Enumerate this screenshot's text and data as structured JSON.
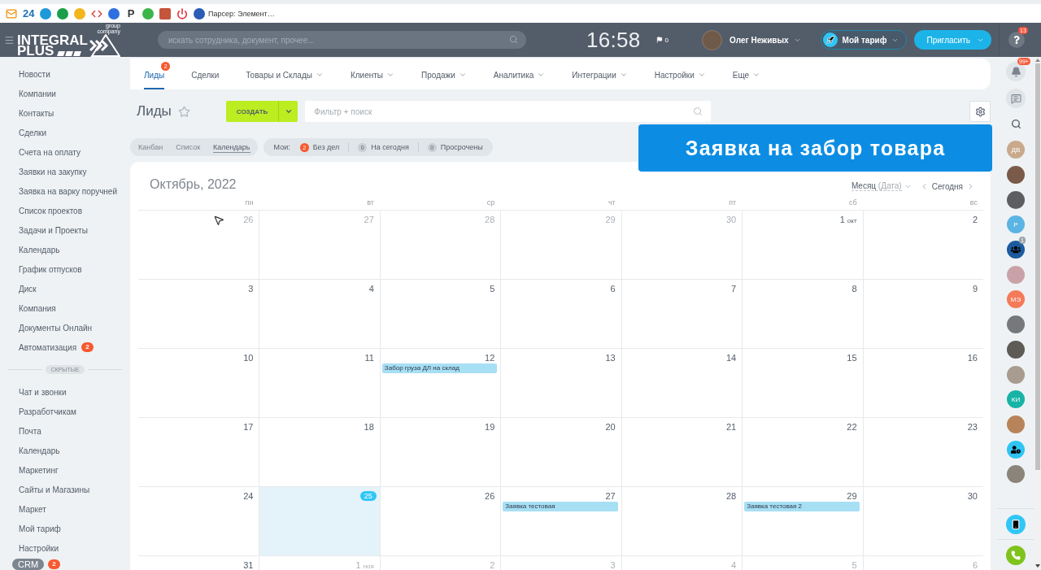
{
  "browser": {
    "bookmarks": [
      {
        "kind": "mail",
        "color": "#f0a02c"
      },
      {
        "kind": "text",
        "label": "24",
        "color": "#1f6fb5"
      },
      {
        "kind": "dot",
        "color": "#1e9ad8"
      },
      {
        "kind": "dot",
        "color": "#1a9e4a"
      },
      {
        "kind": "dot",
        "color": "#f2b51a"
      },
      {
        "kind": "code",
        "color": "#d6453d"
      },
      {
        "kind": "dot",
        "color": "#2f6fe0"
      },
      {
        "kind": "text",
        "label": "P",
        "color": "#333333"
      },
      {
        "kind": "dot",
        "color": "#3cb54a"
      },
      {
        "kind": "square",
        "color": "#c4553b"
      },
      {
        "kind": "power",
        "color": "#e0383e"
      },
      {
        "kind": "dot",
        "color": "#2a5db5",
        "label": "Парсер: Элемент…"
      }
    ]
  },
  "header": {
    "logo": {
      "lines": [
        "INTEGRAL",
        "PLUS"
      ],
      "tagline": [
        "group",
        "company"
      ]
    },
    "search": {
      "placeholder": "искать сотрудника, документ, прочее..."
    },
    "clock": "16:58",
    "flag_count": "0",
    "user": {
      "name": "Олег Неживых"
    },
    "tariff_button": "Мой тариф",
    "invite_button": "Пригласить",
    "help_badge": "13"
  },
  "sidebar": {
    "items": [
      {
        "label": "Новости"
      },
      {
        "label": "Компании"
      },
      {
        "label": "Контакты"
      },
      {
        "label": "Сделки"
      },
      {
        "label": "Счета на оплату"
      },
      {
        "label": "Заявки на закупку"
      },
      {
        "label": "Заявка на варку поручней"
      },
      {
        "label": "Список проектов"
      },
      {
        "label": "Задачи и Проекты"
      },
      {
        "label": "Календарь"
      },
      {
        "label": "График отпусков"
      },
      {
        "label": "Диск"
      },
      {
        "label": "Компания"
      },
      {
        "label": "Документы Онлайн"
      },
      {
        "label": "Автоматизация",
        "badge": "2"
      }
    ],
    "divider": "СКРЫТЫЕ",
    "hidden_items": [
      {
        "label": "Чат и звонки"
      },
      {
        "label": "Разработчикам"
      },
      {
        "label": "Почта"
      },
      {
        "label": "Календарь"
      },
      {
        "label": "Маркетинг"
      },
      {
        "label": "Сайты и Магазины"
      },
      {
        "label": "Маркет"
      },
      {
        "label": "Мой тариф"
      },
      {
        "label": "Настройки"
      }
    ],
    "chip": {
      "label": "CRM",
      "badge": "2"
    }
  },
  "top_nav": {
    "tabs": [
      {
        "label": "Лиды",
        "selected": true,
        "badge": "2",
        "dropdown": false
      },
      {
        "label": "Сделки",
        "selected": false,
        "dropdown": false
      },
      {
        "label": "Товары и Склады",
        "selected": false,
        "dropdown": true
      },
      {
        "label": "Клиенты",
        "selected": false,
        "dropdown": true
      },
      {
        "label": "Продажи",
        "selected": false,
        "dropdown": true
      },
      {
        "label": "Аналитика",
        "selected": false,
        "dropdown": true
      },
      {
        "label": "Интеграции",
        "selected": false,
        "dropdown": true
      },
      {
        "label": "Настройки",
        "selected": false,
        "dropdown": true
      },
      {
        "label": "Еще",
        "selected": false,
        "dropdown": true
      }
    ]
  },
  "toolbar": {
    "title": "Лиды",
    "create_button": "СОЗДАТЬ",
    "filter": {
      "placeholder": "Фильтр + поиск"
    }
  },
  "views": [
    {
      "label": "Канбан",
      "selected": false
    },
    {
      "label": "Список",
      "selected": false
    },
    {
      "label": "Календарь",
      "selected": true
    }
  ],
  "counters": {
    "label": "Мои:",
    "items": [
      {
        "count": "2",
        "label": "Без дел",
        "active": true
      },
      {
        "count": "0",
        "label": "На сегодня",
        "active": false
      },
      {
        "count": "0",
        "label": "Просрочены",
        "active": false
      }
    ]
  },
  "banner": {
    "text": "Заявка на забор товара"
  },
  "calendar": {
    "title": "Октябрь, 2022",
    "view_mode": "Месяц",
    "view_mode_hint": "(Дата)",
    "today_button": "Сегодня",
    "weekdays": [
      "пн",
      "вт",
      "ср",
      "чт",
      "пт",
      "сб",
      "вс"
    ],
    "weeks": [
      {
        "days": [
          {
            "day": "26",
            "outside": true,
            "today": false
          },
          {
            "day": "27",
            "outside": true,
            "today": false
          },
          {
            "day": "28",
            "outside": true,
            "today": false
          },
          {
            "day": "29",
            "outside": true,
            "today": false
          },
          {
            "day": "30",
            "outside": true,
            "today": false
          },
          {
            "day": "1",
            "month": "окт",
            "outside": false,
            "today": false
          },
          {
            "day": "2",
            "outside": false,
            "today": false
          }
        ]
      },
      {
        "days": [
          {
            "day": "3",
            "outside": false,
            "today": false
          },
          {
            "day": "4",
            "outside": false,
            "today": false
          },
          {
            "day": "5",
            "outside": false,
            "today": false
          },
          {
            "day": "6",
            "outside": false,
            "today": false
          },
          {
            "day": "7",
            "outside": false,
            "today": false
          },
          {
            "day": "8",
            "outside": false,
            "today": false
          },
          {
            "day": "9",
            "outside": false,
            "today": false
          }
        ]
      },
      {
        "days": [
          {
            "day": "10",
            "outside": false,
            "today": false
          },
          {
            "day": "11",
            "outside": false,
            "today": false
          },
          {
            "day": "12",
            "outside": false,
            "today": false,
            "events": [
              {
                "title": "Забор груза ДЛ на склад"
              }
            ]
          },
          {
            "day": "13",
            "outside": false,
            "today": false
          },
          {
            "day": "14",
            "outside": false,
            "today": false
          },
          {
            "day": "15",
            "outside": false,
            "today": false
          },
          {
            "day": "16",
            "outside": false,
            "today": false
          }
        ]
      },
      {
        "days": [
          {
            "day": "17",
            "outside": false,
            "today": false
          },
          {
            "day": "18",
            "outside": false,
            "today": false
          },
          {
            "day": "19",
            "outside": false,
            "today": false
          },
          {
            "day": "20",
            "outside": false,
            "today": false
          },
          {
            "day": "21",
            "outside": false,
            "today": false
          },
          {
            "day": "22",
            "outside": false,
            "today": false
          },
          {
            "day": "23",
            "outside": false,
            "today": false
          }
        ]
      },
      {
        "days": [
          {
            "day": "24",
            "outside": false,
            "today": false
          },
          {
            "day": "25",
            "outside": false,
            "today": true
          },
          {
            "day": "26",
            "outside": false,
            "today": false
          },
          {
            "day": "27",
            "outside": false,
            "today": false,
            "events": [
              {
                "title": "Заявка тестовая"
              }
            ]
          },
          {
            "day": "28",
            "outside": false,
            "today": false
          },
          {
            "day": "29",
            "outside": false,
            "today": false,
            "events": [
              {
                "title": "Заявка тестовая 2"
              }
            ]
          },
          {
            "day": "30",
            "outside": false,
            "today": false
          }
        ]
      },
      {
        "days": [
          {
            "day": "31",
            "outside": false,
            "today": false
          },
          {
            "day": "1",
            "month": "ноя",
            "outside": true,
            "today": false
          },
          {
            "day": "2",
            "outside": true,
            "today": false
          },
          {
            "day": "3",
            "outside": true,
            "today": false
          },
          {
            "day": "4",
            "outside": true,
            "today": false
          },
          {
            "day": "5",
            "outside": true,
            "today": false
          },
          {
            "day": "6",
            "outside": true,
            "today": false
          }
        ]
      }
    ]
  },
  "right_bar": {
    "bell_badge": "99+",
    "items": [
      {
        "kind": "initials",
        "label": "ДВ",
        "color": "#c9a98b"
      },
      {
        "kind": "photo",
        "color": "#7a5a48"
      },
      {
        "kind": "photo",
        "color": "#5d5e62"
      },
      {
        "kind": "initials",
        "label": "Р",
        "color": "#5ab4e4"
      },
      {
        "kind": "group",
        "badge": "1",
        "color": "#1c5b9e"
      },
      {
        "kind": "photo",
        "color": "#c9a2a8"
      },
      {
        "kind": "initials",
        "label": "МЭ",
        "color": "#f47a5a"
      },
      {
        "kind": "photo",
        "color": "#76787c"
      },
      {
        "kind": "photo",
        "color": "#5e5a56"
      },
      {
        "kind": "photo",
        "color": "#a89c90"
      },
      {
        "kind": "initials",
        "label": "КИ",
        "color": "#17b3a6"
      },
      {
        "kind": "photo",
        "color": "#b8835a"
      },
      {
        "kind": "user-clock",
        "color": "#2ec5f5"
      },
      {
        "kind": "photo",
        "color": "#8a847a"
      }
    ],
    "bottom": [
      {
        "kind": "devices",
        "color": "#2fc6f6"
      },
      {
        "kind": "call",
        "color": "#7fc31d"
      }
    ]
  }
}
